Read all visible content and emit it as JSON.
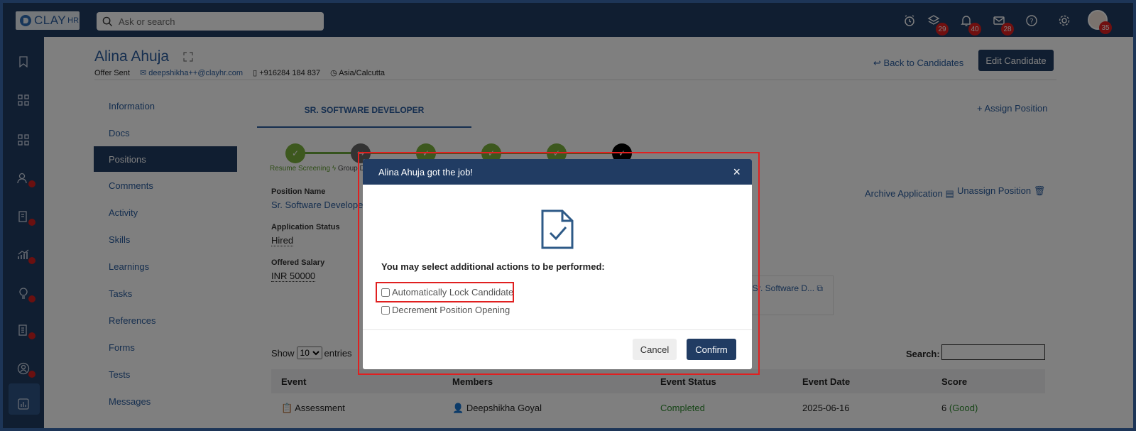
{
  "topbar": {
    "logo_text": "CLAY",
    "logo_hr": "HR",
    "search_placeholder": "Ask or search",
    "icons": [
      {
        "name": "alarm-icon",
        "badge": ""
      },
      {
        "name": "layers-icon",
        "badge": "29"
      },
      {
        "name": "bell-icon",
        "badge": "40"
      },
      {
        "name": "mail-icon",
        "badge": "28"
      },
      {
        "name": "help-icon",
        "badge": ""
      },
      {
        "name": "gear-icon",
        "badge": ""
      }
    ],
    "avatar_badge": "35"
  },
  "candidate": {
    "name": "Alina Ahuja",
    "status": "Offer Sent",
    "email": "deepshikha++@clayhr.com",
    "phone": "+916284 184 837",
    "timezone": "Asia/Calcutta"
  },
  "header_actions": {
    "back": "Back to Candidates",
    "edit": "Edit Candidate"
  },
  "nav": [
    "Information",
    "Docs",
    "Positions",
    "Comments",
    "Activity",
    "Skills",
    "Learnings",
    "Tasks",
    "References",
    "Forms",
    "Tests",
    "Messages"
  ],
  "position": {
    "tab": "SR. SOFTWARE DEVELOPER",
    "assign": "Assign Position",
    "stage_first": "Resume Screening",
    "stage_second": "Group D",
    "name_label": "Position Name",
    "name_value": "Sr. Software Developer",
    "status_label": "Application Status",
    "status_value": "Hired",
    "salary_label": "Offered Salary",
    "salary_value": "INR 50000",
    "archive": "Archive Application",
    "unassign": "Unassign Position",
    "offer_link": ": Sr. Software D..."
  },
  "table": {
    "show": "Show",
    "entries_value": "10",
    "entries": "entries",
    "search_label": "Search:",
    "headers": [
      "Event",
      "Members",
      "Event Status",
      "Event Date",
      "Score"
    ],
    "row": {
      "event": "Assessment",
      "member": "Deepshikha Goyal",
      "status": "Completed",
      "date": "2025-06-16",
      "score": "6",
      "score_note": "(Good)"
    }
  },
  "modal": {
    "title": "Alina Ahuja got the job!",
    "close": "×",
    "message": "You may select additional actions to be performed:",
    "option1": "Automatically Lock Candidate",
    "option2": "Decrement Position Opening",
    "cancel": "Cancel",
    "confirm": "Confirm"
  }
}
